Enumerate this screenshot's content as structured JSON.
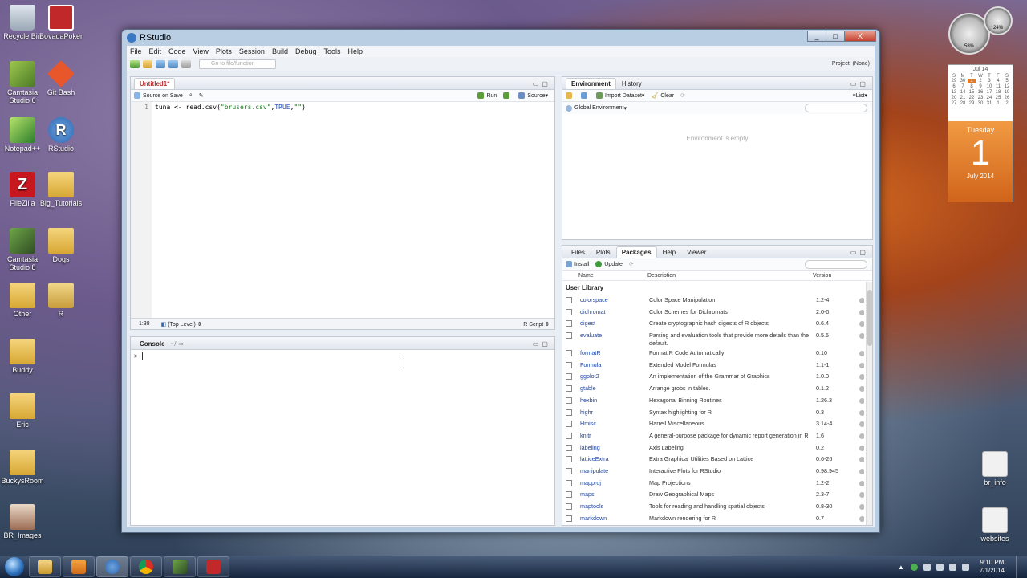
{
  "desktop_icons": [
    {
      "label": "Recycle Bin",
      "icon": "recycle-bin-icon"
    },
    {
      "label": "BovadaPoker",
      "icon": "poker-icon"
    },
    {
      "label": "Camtasia Studio 6",
      "icon": "camtasia-icon"
    },
    {
      "label": "Git Bash",
      "icon": "git-bash-icon"
    },
    {
      "label": "Notepad++",
      "icon": "notepad-icon"
    },
    {
      "label": "RStudio",
      "icon": "rstudio-icon"
    },
    {
      "label": "FileZilla",
      "icon": "filezilla-icon"
    },
    {
      "label": "Big_Tutorials",
      "icon": "folder-icon"
    },
    {
      "label": "Camtasia Studio 8",
      "icon": "camtasia-icon"
    },
    {
      "label": "Dogs",
      "icon": "folder-icon"
    },
    {
      "label": "Other",
      "icon": "folder-icon"
    },
    {
      "label": "R",
      "icon": "r-file-icon"
    },
    {
      "label": "Buddy",
      "icon": "folder-icon"
    },
    {
      "label": "Eric",
      "icon": "folder-icon"
    },
    {
      "label": "BuckysRoom",
      "icon": "folder-icon"
    },
    {
      "label": "BR_Images",
      "icon": "image-folder-icon"
    },
    {
      "label": "br_info",
      "icon": "document-icon"
    },
    {
      "label": "websites",
      "icon": "document-icon"
    }
  ],
  "gadgets": {
    "cpu_percent": "58%",
    "mem_percent": "24%",
    "calendar": {
      "month_label": "Jul 14",
      "weekdays": [
        "S",
        "M",
        "T",
        "W",
        "T",
        "F",
        "S"
      ],
      "days": [
        "29",
        "30",
        "1",
        "2",
        "3",
        "4",
        "5",
        "6",
        "7",
        "8",
        "9",
        "10",
        "11",
        "12",
        "13",
        "14",
        "15",
        "16",
        "17",
        "18",
        "19",
        "20",
        "21",
        "22",
        "23",
        "24",
        "25",
        "26",
        "27",
        "28",
        "29",
        "30",
        "31",
        "1",
        "2"
      ],
      "today_index": 2,
      "weekday": "Tuesday",
      "day": "1",
      "month_year": "July 2014"
    }
  },
  "window": {
    "title": "RStudio",
    "buttons": [
      "_",
      "□",
      "X"
    ]
  },
  "menu": [
    "File",
    "Edit",
    "Code",
    "View",
    "Plots",
    "Session",
    "Build",
    "Debug",
    "Tools",
    "Help"
  ],
  "toolbar": {
    "goto_placeholder": "Go to file/function",
    "project": "Project: (None)"
  },
  "editor": {
    "tab_label": "Untitled1*",
    "source_on_save": "Source on Save",
    "run_label": "Run",
    "source_label": "Source",
    "line_number": "1",
    "code_prefix": "tuna <- read.csv(",
    "code_arg1": "\"brusers.csv\"",
    "code_sep1": ",",
    "code_arg2": "TRUE",
    "code_sep2": ",",
    "code_arg3": "\"\"",
    "code_suffix": ")",
    "position": "1:38",
    "scope": "(Top Level)",
    "file_type": "R Script"
  },
  "console": {
    "title": "Console",
    "path": "~/",
    "prompt": ">"
  },
  "environment": {
    "tabs": [
      "Environment",
      "History"
    ],
    "import_label": "Import Dataset",
    "clear_label": "Clear",
    "global_env": "Global Environment",
    "list_label": "List",
    "empty_text": "Environment is empty"
  },
  "packages": {
    "tabs": [
      "Files",
      "Plots",
      "Packages",
      "Help",
      "Viewer"
    ],
    "install_label": "Install",
    "update_label": "Update",
    "columns": [
      "Name",
      "Description",
      "Version"
    ],
    "library_title": "User Library",
    "rows": [
      {
        "name": "colorspace",
        "desc": "Color Space Manipulation",
        "ver": "1.2-4"
      },
      {
        "name": "dichromat",
        "desc": "Color Schemes for Dichromats",
        "ver": "2.0-0"
      },
      {
        "name": "digest",
        "desc": "Create cryptographic hash digests of R objects",
        "ver": "0.6.4"
      },
      {
        "name": "evaluate",
        "desc": "Parsing and evaluation tools that provide more details than the default.",
        "ver": "0.5.5"
      },
      {
        "name": "formatR",
        "desc": "Format R Code Automatically",
        "ver": "0.10"
      },
      {
        "name": "Formula",
        "desc": "Extended Model Formulas",
        "ver": "1.1-1"
      },
      {
        "name": "ggplot2",
        "desc": "An implementation of the Grammar of Graphics",
        "ver": "1.0.0"
      },
      {
        "name": "gtable",
        "desc": "Arrange grobs in tables.",
        "ver": "0.1.2"
      },
      {
        "name": "hexbin",
        "desc": "Hexagonal Binning Routines",
        "ver": "1.26.3"
      },
      {
        "name": "highr",
        "desc": "Syntax highlighting for R",
        "ver": "0.3"
      },
      {
        "name": "Hmisc",
        "desc": "Harrell Miscellaneous",
        "ver": "3.14-4"
      },
      {
        "name": "knitr",
        "desc": "A general-purpose package for dynamic report generation in R",
        "ver": "1.6"
      },
      {
        "name": "labeling",
        "desc": "Axis Labeling",
        "ver": "0.2"
      },
      {
        "name": "latticeExtra",
        "desc": "Extra Graphical Utilities Based on Lattice",
        "ver": "0.6-26"
      },
      {
        "name": "manipulate",
        "desc": "Interactive Plots for RStudio",
        "ver": "0.98.945"
      },
      {
        "name": "mapproj",
        "desc": "Map Projections",
        "ver": "1.2-2"
      },
      {
        "name": "maps",
        "desc": "Draw Geographical Maps",
        "ver": "2.3-7"
      },
      {
        "name": "maptools",
        "desc": "Tools for reading and handling spatial objects",
        "ver": "0.8-30"
      },
      {
        "name": "markdown",
        "desc": "Markdown rendering for R",
        "ver": "0.7"
      }
    ]
  },
  "taskbar": {
    "time": "9:10 PM",
    "date": "7/1/2014",
    "apps": [
      "explorer-icon",
      "media-player-icon",
      "rstudio-icon",
      "chrome-icon",
      "camtasia-icon",
      "poker-icon"
    ]
  }
}
